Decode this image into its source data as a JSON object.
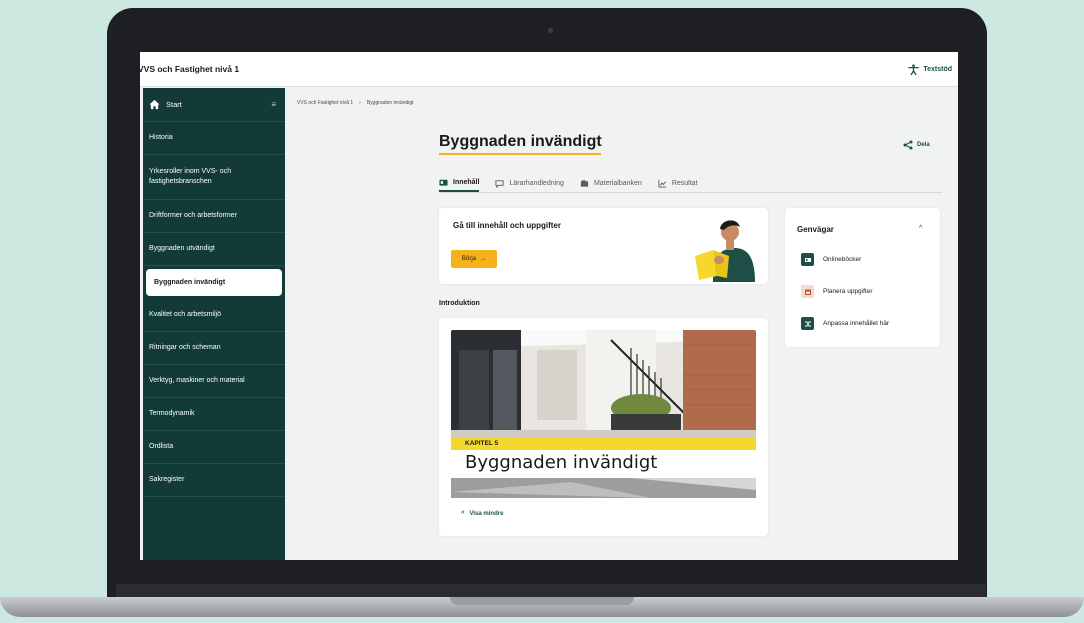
{
  "app": {
    "title": "VVS och Fastighet nivå 1",
    "text_support": "Textstöd"
  },
  "sidebar": {
    "start_label": "Start",
    "items": [
      {
        "label": "Historia"
      },
      {
        "label": "Yrkesroller inom VVS- och fastighetsbranschen"
      },
      {
        "label": "Driftformer och arbetsformer"
      },
      {
        "label": "Byggnaden utvändigt"
      },
      {
        "label": "Byggnaden invändigt",
        "active": true
      },
      {
        "label": "Kvalitet och arbetsmiljö"
      },
      {
        "label": "Ritningar och scheman"
      },
      {
        "label": "Verktyg, maskiner och material"
      },
      {
        "label": "Termodynamik"
      },
      {
        "label": "Ordlista"
      },
      {
        "label": "Sakregister"
      }
    ]
  },
  "breadcrumb": {
    "root": "VVS och Fastighet nivå 1",
    "separator": "›",
    "current": "Byggnaden invändigt"
  },
  "page": {
    "title": "Byggnaden invändigt",
    "share_label": "Dela"
  },
  "tabs": [
    {
      "label": "Innehåll",
      "icon": "book-icon",
      "active": true
    },
    {
      "label": "Lärarhandledning",
      "icon": "chat-icon"
    },
    {
      "label": "Materialbanken",
      "icon": "folder-icon"
    },
    {
      "label": "Resultat",
      "icon": "chart-icon"
    }
  ],
  "goto": {
    "title": "Gå till innehåll och uppgifter",
    "button": "Börja",
    "button_arrow": "→"
  },
  "intro": {
    "label": "Introduktion",
    "chapter": "KAPITEL 5",
    "chapter_title": "Byggnaden invändigt",
    "toggle_label": "Visa mindre",
    "toggle_icon": "^"
  },
  "shortcuts": {
    "title": "Genvägar",
    "chevron": "^",
    "items": [
      {
        "label": "Onlineböcker",
        "color": "#1e4f47"
      },
      {
        "label": "Planera uppgifter",
        "color": "#f3d9d2"
      },
      {
        "label": "Anpassa innehållet här",
        "color": "#1e4f47"
      }
    ]
  },
  "colors": {
    "sidebar": "#123a36",
    "accent": "#f5b21d",
    "brand": "#1e4f47"
  }
}
